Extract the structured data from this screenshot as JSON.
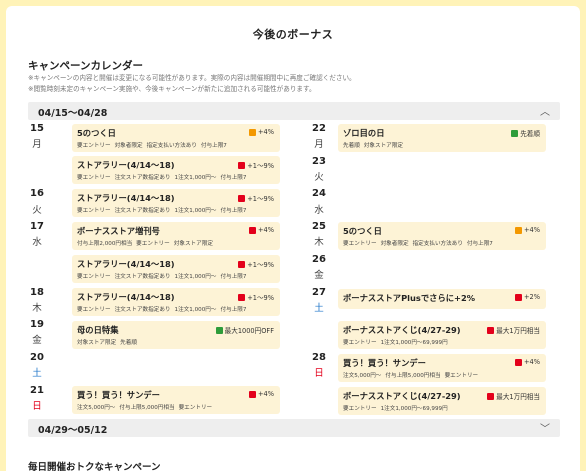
{
  "page_title": "今後のボーナス",
  "calendar_heading": "キャンペーンカレンダー",
  "notes": [
    "※キャンペーンの内容と開催は変更になる可能性があります。実際の内容は開催期間中に再度ご確認ください。",
    "※閲覧時刻未定のキャンペーン実施や、今後キャンペーンが新たに追加される可能性があります。"
  ],
  "range1": {
    "label": "04/15〜04/28",
    "chevron": "︿"
  },
  "range2": {
    "label": "04/29〜05/12",
    "chevron": "﹀"
  },
  "days": {
    "d15": {
      "num": "15",
      "wd": "月"
    },
    "d16": {
      "num": "16",
      "wd": "火"
    },
    "d17": {
      "num": "17",
      "wd": "水"
    },
    "d18": {
      "num": "18",
      "wd": "木"
    },
    "d19": {
      "num": "19",
      "wd": "金"
    },
    "d20": {
      "num": "20",
      "wd": "土"
    },
    "d21": {
      "num": "21",
      "wd": "日"
    },
    "d22": {
      "num": "22",
      "wd": "月"
    },
    "d23": {
      "num": "23",
      "wd": "火"
    },
    "d24": {
      "num": "24",
      "wd": "水"
    },
    "d25": {
      "num": "25",
      "wd": "木"
    },
    "d26": {
      "num": "26",
      "wd": "金"
    },
    "d27": {
      "num": "27",
      "wd": "土"
    },
    "d28": {
      "num": "28",
      "wd": "日"
    }
  },
  "cards": {
    "c15a": {
      "title": "5のつく日",
      "badge": "+4%",
      "tags": [
        "要エントリー",
        "対象者限定",
        "指定支払い方法あり",
        "付与上限7"
      ]
    },
    "c15b": {
      "title": "ストアラリー(4/14〜18)",
      "badge": "+1〜9%",
      "tags": [
        "要エントリー",
        "注文ストア数指定あり",
        "1注文1,000円〜",
        "付与上限7"
      ]
    },
    "c16": {
      "title": "ストアラリー(4/14〜18)",
      "badge": "+1〜9%",
      "tags": [
        "要エントリー",
        "注文ストア数指定あり",
        "1注文1,000円〜",
        "付与上限7"
      ]
    },
    "c17a": {
      "title": "ボーナスストア増刊号",
      "badge": "+4%",
      "tags": [
        "付与上限2,000円相当",
        "要エントリー",
        "対象ストア限定"
      ]
    },
    "c17b": {
      "title": "ストアラリー(4/14〜18)",
      "badge": "+1〜9%",
      "tags": [
        "要エントリー",
        "注文ストア数指定あり",
        "1注文1,000円〜",
        "付与上限7"
      ]
    },
    "c18": {
      "title": "ストアラリー(4/14〜18)",
      "badge": "+1〜9%",
      "tags": [
        "要エントリー",
        "注文ストア数指定あり",
        "1注文1,000円〜",
        "付与上限7"
      ]
    },
    "c19": {
      "title": "母の日特集",
      "badge": "最大1000円OFF",
      "tags": [
        "対象ストア限定",
        "先着順"
      ]
    },
    "c21": {
      "title": "買う！買う！サンデー",
      "badge": "+4%",
      "tags": [
        "注文5,000円〜",
        "付与上限5,000円相当",
        "要エントリー"
      ]
    },
    "c22": {
      "title": "ゾロ目の日",
      "badge": "先着順",
      "tags": [
        "先着順",
        "対象ストア限定"
      ]
    },
    "c25": {
      "title": "5のつく日",
      "badge": "+4%",
      "tags": [
        "要エントリー",
        "対象者限定",
        "指定支払い方法あり",
        "付与上限7"
      ]
    },
    "c27a": {
      "title": "ボーナスストアPlusでさらに+2%",
      "badge": "+2%",
      "tags": []
    },
    "c27b": {
      "title": "ボーナスストアくじ(4/27-29)",
      "badge": "最大1万円相当",
      "tags": [
        "要エントリー",
        "1注文1,000円〜69,999円"
      ]
    },
    "c28a": {
      "title": "買う！買う！サンデー",
      "badge": "+4%",
      "tags": [
        "注文5,000円〜",
        "付与上限5,000円相当",
        "要エントリー"
      ]
    },
    "c28b": {
      "title": "ボーナスストアくじ(4/27-29)",
      "badge": "最大1万円相当",
      "tags": [
        "要エントリー",
        "1注文1,000円〜69,999円"
      ]
    }
  },
  "bottom_heading": "毎日開催おトクなキャンペーン",
  "colors": {
    "card_bg": "#fdf3d6",
    "bar_bg": "#eeeeee",
    "saturday": "#1d74c9",
    "sunday": "#e3001b",
    "frame": "#fff3b8"
  }
}
